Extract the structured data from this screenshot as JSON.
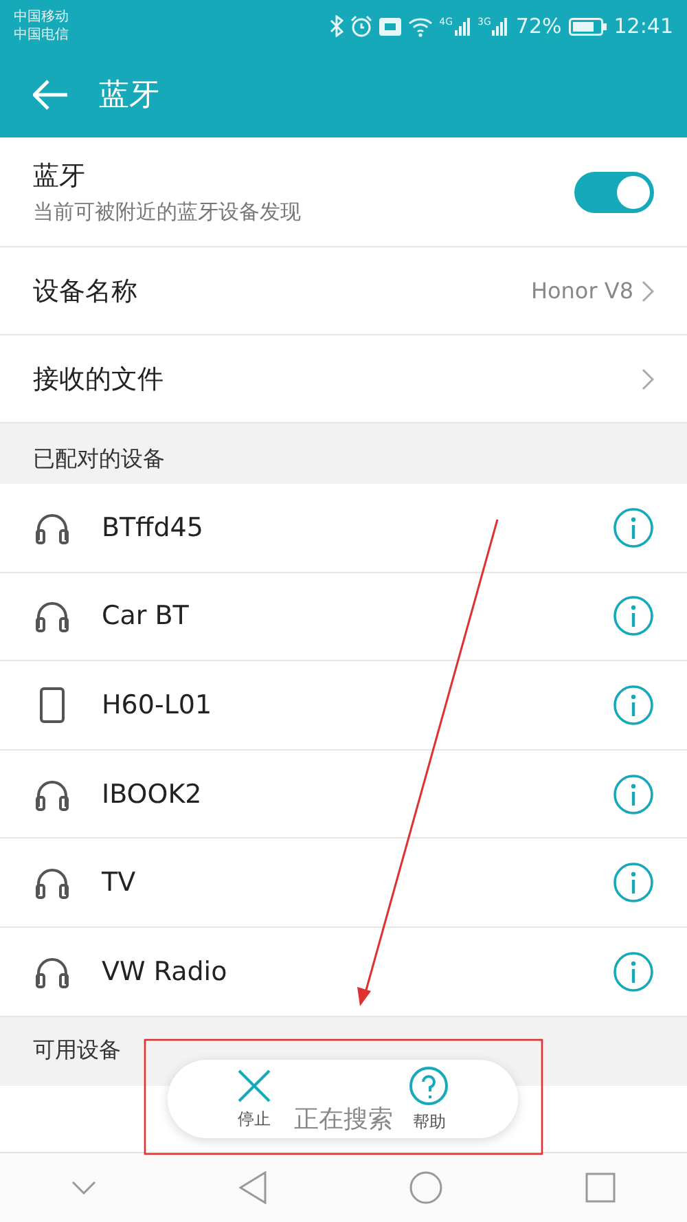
{
  "status_bar": {
    "carriers": [
      "中国移动",
      "中国电信"
    ],
    "signal_1_label": "4G",
    "signal_2_label": "3G",
    "battery": "72%",
    "time": "12:41"
  },
  "header": {
    "title": "蓝牙"
  },
  "bluetooth": {
    "label": "蓝牙",
    "description": "当前可被附近的蓝牙设备发现",
    "on": true
  },
  "settings": [
    {
      "label": "设备名称",
      "value": "Honor V8"
    },
    {
      "label": "接收的文件"
    }
  ],
  "paired_section": {
    "title": "已配对的设备"
  },
  "paired_devices": [
    {
      "name": "BTffd45",
      "kind": "headset"
    },
    {
      "name": "Car BT",
      "kind": "headset"
    },
    {
      "name": "H60-L01",
      "kind": "phone"
    },
    {
      "name": "IBOOK2",
      "kind": "headset"
    },
    {
      "name": "TV",
      "kind": "headset"
    },
    {
      "name": "VW Radio",
      "kind": "headset"
    }
  ],
  "available_section": {
    "title": "可用设备",
    "status": "正在搜索"
  },
  "actions": [
    {
      "label": "停止",
      "kind": "stop"
    },
    {
      "label": "帮助",
      "kind": "help"
    }
  ]
}
